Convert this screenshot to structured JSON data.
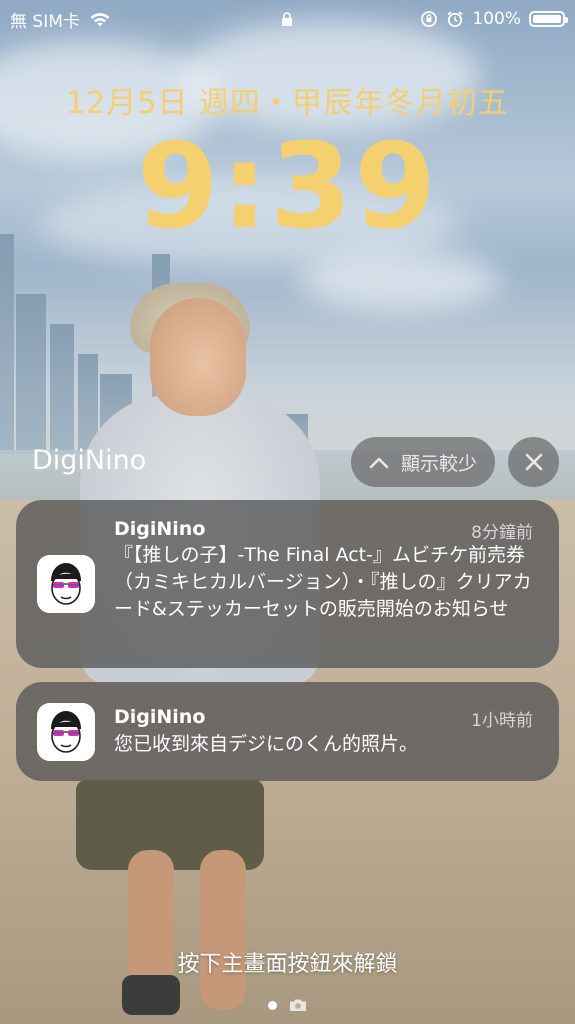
{
  "status_bar": {
    "carrier": "無 SIM卡",
    "battery": "100%",
    "icons": [
      "wifi-icon",
      "lock-icon",
      "rotation-lock-icon",
      "alarm-icon",
      "battery-icon"
    ]
  },
  "lock_screen": {
    "date": "12月5日 週四・甲辰年冬月初五",
    "time": "9:39"
  },
  "group": {
    "app_name": "DigiNino",
    "show_less_label": "顯示較少",
    "icons": [
      "chevron-up-icon",
      "close-icon"
    ]
  },
  "notifications": [
    {
      "app": "DigiNino",
      "time": "8分鐘前",
      "body": "『【推しの子】-The Final Act-』ムビチケ前売券（カミキヒカルバージョン）・『推しの』クリアカード&ステッカーセットの販売開始のお知らせ"
    },
    {
      "app": "DigiNino",
      "time": "1小時前",
      "body": "您已收到來自デジにのくん的照片。"
    }
  ],
  "footer": {
    "unlock_hint": "按下主畫面按鈕來解鎖",
    "icons": [
      "page-dot-icon",
      "camera-icon"
    ]
  },
  "colors": {
    "time_yellow": "#f4d06e",
    "notification_bg": "#5c5c5c"
  }
}
